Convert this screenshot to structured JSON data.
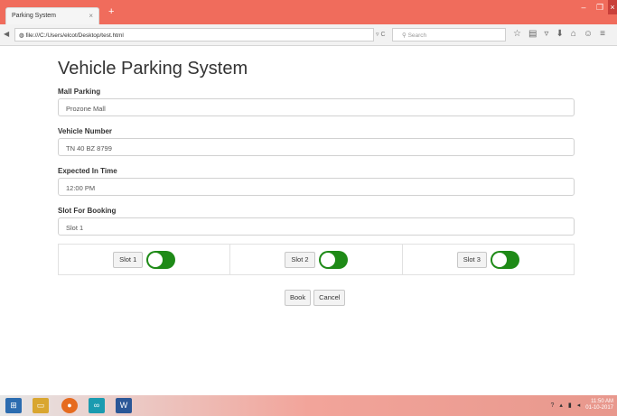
{
  "browser": {
    "tab_title": "Parking System",
    "tab_close": "×",
    "new_tab": "+",
    "url": "file:///C:/Users/elcot/Desktop/test.html",
    "search_placeholder": "Search",
    "window_controls": [
      "–",
      "❐",
      "×"
    ]
  },
  "page": {
    "title": "Vehicle Parking System",
    "fields": [
      {
        "label": "Mall Parking",
        "value": "Prozone Mall"
      },
      {
        "label": "Vehicle Number",
        "value": "TN 40 BZ 8799"
      },
      {
        "label": "Expected In Time",
        "value": "12:00 PM"
      },
      {
        "label": "Slot For Booking",
        "value": "Slot 1"
      }
    ],
    "slots": [
      {
        "label": "Slot 1",
        "enabled": true
      },
      {
        "label": "Slot 2",
        "enabled": true
      },
      {
        "label": "Slot 3",
        "enabled": true
      }
    ],
    "actions": {
      "book": "Book",
      "cancel": "Cancel"
    }
  },
  "taskbar": {
    "clock_time": "11:50 AM",
    "clock_date": "01-10-2017"
  },
  "colors": {
    "tabbar": "#f06c5c",
    "toggle_on": "#1e8a17"
  }
}
